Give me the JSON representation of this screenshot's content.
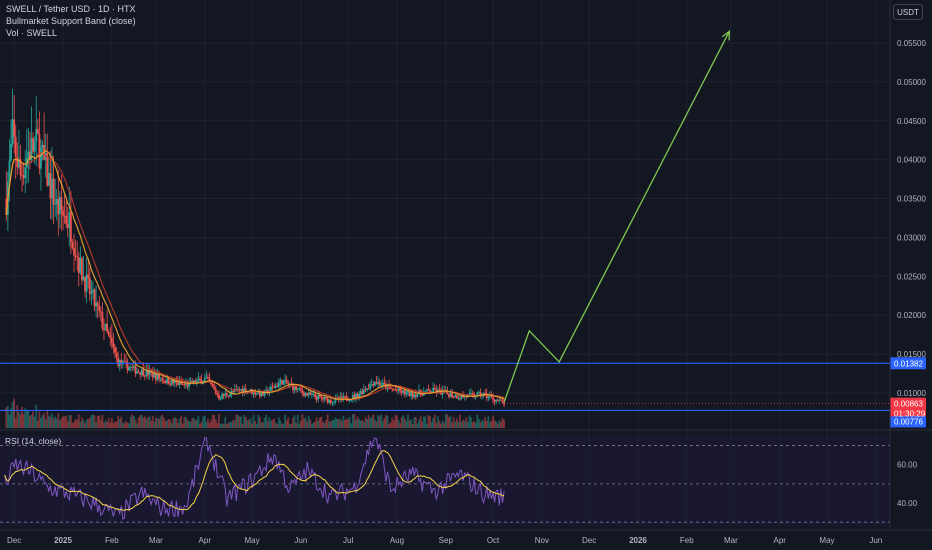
{
  "header": {
    "symbol_line": "SWELL / Tether USD · 1D · HTX",
    "indicator_line": "Bullmarket Support Band (close)",
    "volume_line": "Vol · SWELL"
  },
  "quote_button": "USDT",
  "rsi_label": "RSI (14, close)",
  "colors": {
    "background": "#131722",
    "up_candle": "#26a69a",
    "down_candle": "#ef5350",
    "support_band_fast": "#f0a830",
    "support_band_slow": "#c0392b",
    "horizontal_lines": "#2962ff",
    "projection_arrow": "#7ec850",
    "rsi_line": "#7e57c2",
    "rsi_ma": "#f5d547",
    "price_badge": "#f23645"
  },
  "chart_data": [
    {
      "type": "candlestick",
      "x_axis": {
        "tick_labels": [
          "Dec",
          "2025",
          "Feb",
          "Mar",
          "Apr",
          "May",
          "Jun",
          "Jul",
          "Aug",
          "Sep",
          "Oct",
          "Nov",
          "Dec",
          "2026",
          "Feb",
          "Mar",
          "Apr",
          "May",
          "Jun"
        ],
        "range": [
          "2024-11-22",
          "2026-06-10"
        ]
      },
      "y_axis": {
        "tick_labels": [
          "0.05500",
          "0.05000",
          "0.04500",
          "0.04000",
          "0.03500",
          "0.03000",
          "0.02500",
          "0.02000",
          "0.01500",
          "0.01000"
        ],
        "ylim": [
          0.0055,
          0.0595
        ]
      },
      "price_path": [
        {
          "date": "2024-11-26",
          "price": 0.035
        },
        {
          "date": "2024-11-30",
          "price": 0.043
        },
        {
          "date": "2024-12-05",
          "price": 0.038
        },
        {
          "date": "2024-12-10",
          "price": 0.041
        },
        {
          "date": "2024-12-16",
          "price": 0.042
        },
        {
          "date": "2024-12-22",
          "price": 0.038
        },
        {
          "date": "2024-12-28",
          "price": 0.034
        },
        {
          "date": "2025-01-05",
          "price": 0.032
        },
        {
          "date": "2025-01-12",
          "price": 0.026
        },
        {
          "date": "2025-01-20",
          "price": 0.022
        },
        {
          "date": "2025-01-28",
          "price": 0.018
        },
        {
          "date": "2025-02-05",
          "price": 0.014
        },
        {
          "date": "2025-02-15",
          "price": 0.013
        },
        {
          "date": "2025-02-25",
          "price": 0.0125
        },
        {
          "date": "2025-03-08",
          "price": 0.0115
        },
        {
          "date": "2025-03-20",
          "price": 0.011
        },
        {
          "date": "2025-04-02",
          "price": 0.0118
        },
        {
          "date": "2025-04-10",
          "price": 0.0095
        },
        {
          "date": "2025-04-25",
          "price": 0.0105
        },
        {
          "date": "2025-05-08",
          "price": 0.0098
        },
        {
          "date": "2025-05-20",
          "price": 0.0115
        },
        {
          "date": "2025-06-05",
          "price": 0.0098
        },
        {
          "date": "2025-06-20",
          "price": 0.009
        },
        {
          "date": "2025-07-05",
          "price": 0.0095
        },
        {
          "date": "2025-07-18",
          "price": 0.0115
        },
        {
          "date": "2025-07-28",
          "price": 0.0105
        },
        {
          "date": "2025-08-10",
          "price": 0.0098
        },
        {
          "date": "2025-08-25",
          "price": 0.0103
        },
        {
          "date": "2025-09-10",
          "price": 0.0095
        },
        {
          "date": "2025-09-25",
          "price": 0.0098
        },
        {
          "date": "2025-10-08",
          "price": 0.00863
        }
      ],
      "current_price": "0.00863",
      "countdown": "01:30:29",
      "horizontal_levels": [
        {
          "value": 0.01382,
          "label": "0.01382"
        },
        {
          "value": 0.00776,
          "label": "0.00776"
        }
      ],
      "projection_path": [
        {
          "date": "2025-10-08",
          "price": 0.0088
        },
        {
          "date": "2025-10-24",
          "price": 0.018
        },
        {
          "date": "2025-11-12",
          "price": 0.014
        },
        {
          "date": "2026-02-28",
          "price": 0.0565
        }
      ],
      "volume_panel": true,
      "grid": true
    },
    {
      "type": "line",
      "title": "RSI (14, close)",
      "y_axis": {
        "tick_labels": [
          "60.00",
          "40.00"
        ],
        "ylim": [
          28,
          75
        ]
      },
      "guide_levels": [
        70,
        50,
        30
      ],
      "rsi_path": [
        {
          "date": "2024-11-25",
          "value": 50
        },
        {
          "date": "2024-12-02",
          "value": 60
        },
        {
          "date": "2024-12-12",
          "value": 56
        },
        {
          "date": "2024-12-22",
          "value": 48
        },
        {
          "date": "2025-01-05",
          "value": 45
        },
        {
          "date": "2025-01-20",
          "value": 40
        },
        {
          "date": "2025-02-05",
          "value": 33
        },
        {
          "date": "2025-02-20",
          "value": 45
        },
        {
          "date": "2025-03-05",
          "value": 37
        },
        {
          "date": "2025-03-20",
          "value": 38
        },
        {
          "date": "2025-04-02",
          "value": 74
        },
        {
          "date": "2025-04-15",
          "value": 42
        },
        {
          "date": "2025-05-01",
          "value": 52
        },
        {
          "date": "2025-05-15",
          "value": 65
        },
        {
          "date": "2025-05-25",
          "value": 47
        },
        {
          "date": "2025-06-05",
          "value": 57
        },
        {
          "date": "2025-06-20",
          "value": 43
        },
        {
          "date": "2025-07-05",
          "value": 48
        },
        {
          "date": "2025-07-18",
          "value": 76
        },
        {
          "date": "2025-07-28",
          "value": 47
        },
        {
          "date": "2025-08-10",
          "value": 55
        },
        {
          "date": "2025-08-25",
          "value": 46
        },
        {
          "date": "2025-09-10",
          "value": 55
        },
        {
          "date": "2025-09-25",
          "value": 45
        },
        {
          "date": "2025-10-08",
          "value": 43
        }
      ]
    }
  ]
}
